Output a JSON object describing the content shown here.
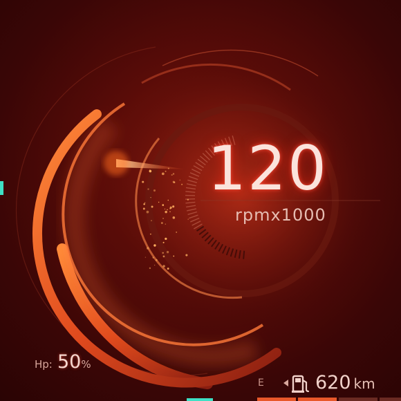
{
  "speed": {
    "value": "120",
    "unit": "rpmx1000"
  },
  "hp": {
    "label": "Hp:",
    "value": "50",
    "unit": "%",
    "level": 0.5
  },
  "fuel": {
    "empty_label": "E",
    "range_value": "620",
    "range_unit": "km",
    "segments_total": 4,
    "segments_filled": 2,
    "pump_icon": "fuel-pump-icon"
  },
  "colors": {
    "accent": "#ff6a2a",
    "accent_dim": "#b83a18",
    "indicator": "#3fe0c5",
    "text": "#fbe3dc",
    "segment_filled": "#e8582a",
    "segment_empty": "#6a2a22"
  }
}
